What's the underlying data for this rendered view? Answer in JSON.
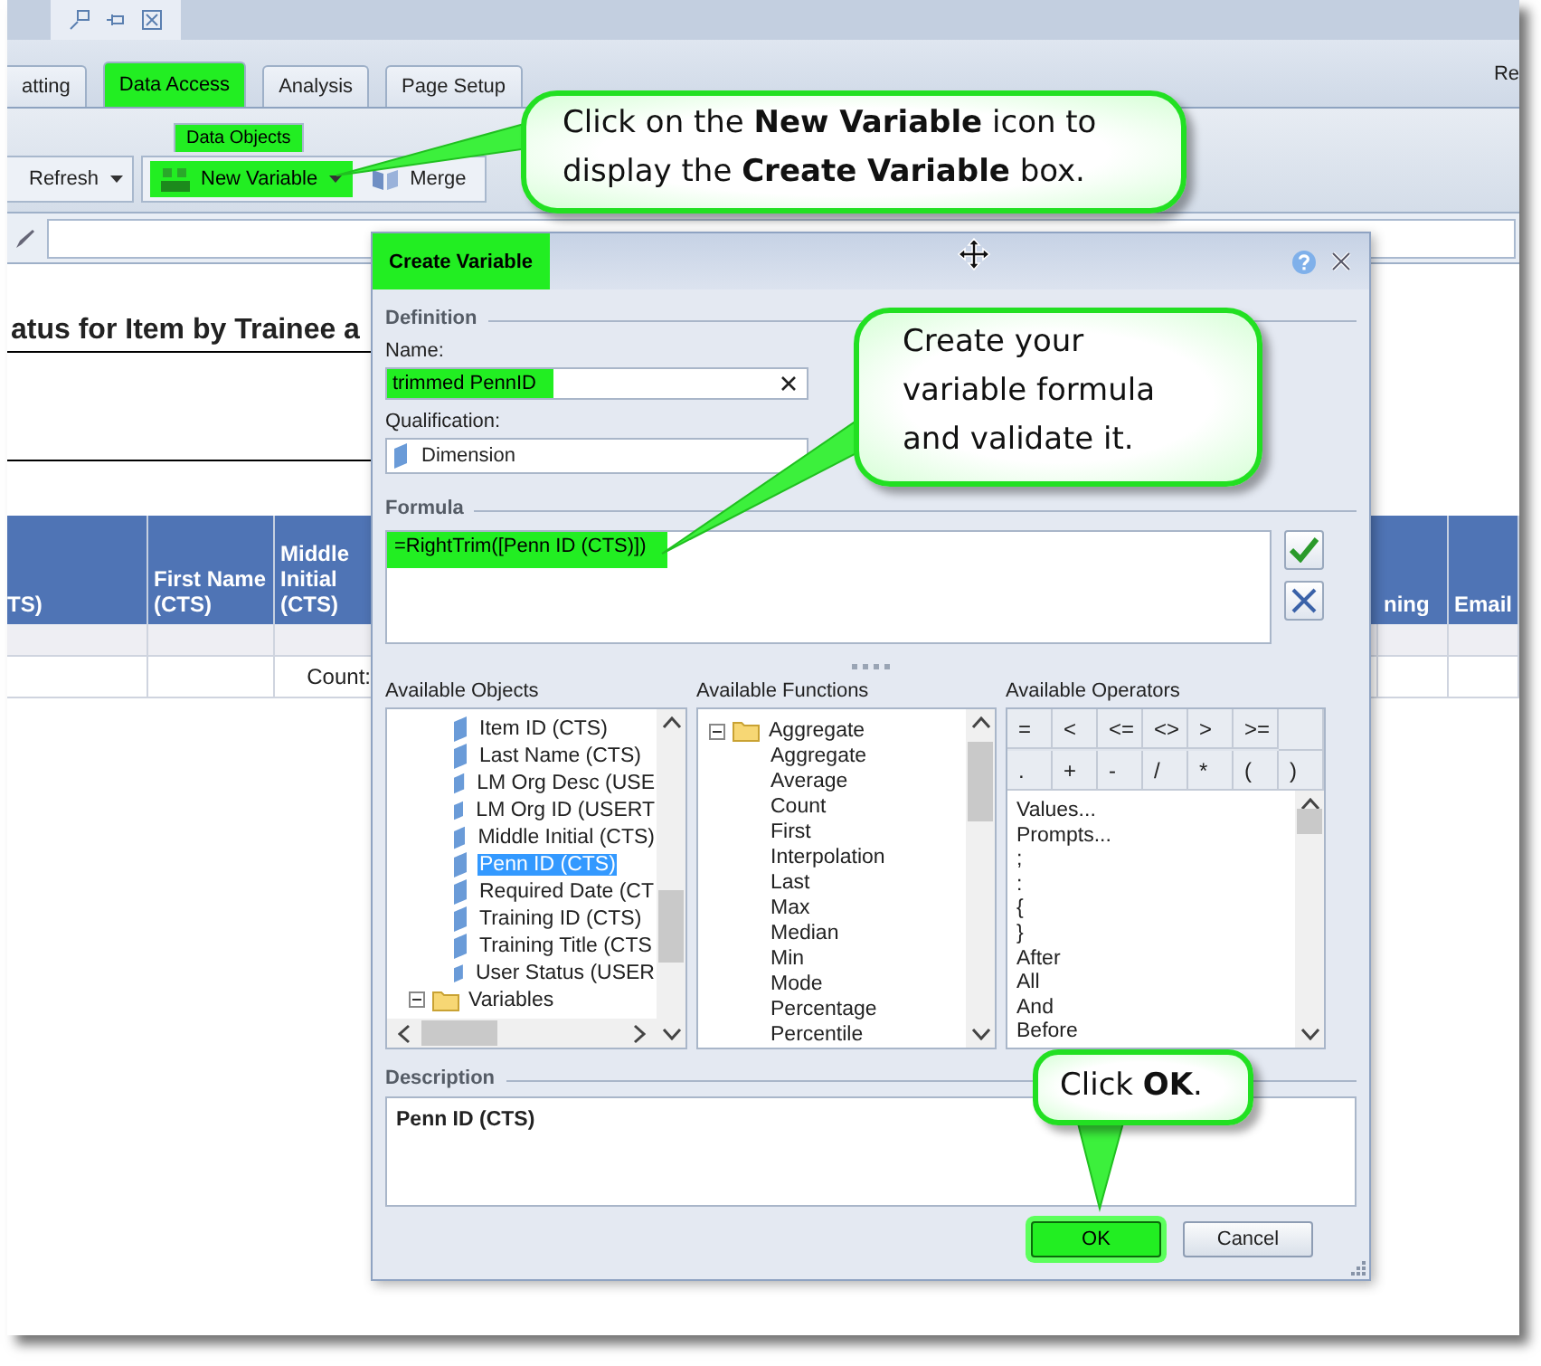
{
  "ribbon_tabs": [
    {
      "label": "atting",
      "selected": false,
      "highlighted": false
    },
    {
      "label": "Data Access",
      "selected": true,
      "highlighted": true
    },
    {
      "label": "Analysis",
      "selected": false,
      "highlighted": false
    },
    {
      "label": "Page Setup",
      "selected": false,
      "highlighted": false
    }
  ],
  "ribbon_right_text": "Re",
  "ribbon_group": {
    "label": "Data Objects",
    "highlighted": true
  },
  "ribbon_buttons": [
    {
      "label": "Refresh",
      "kind": "dropdown",
      "highlighted": false
    },
    {
      "label": "New Variable",
      "kind": "dropdown",
      "highlighted": true
    },
    {
      "label": "Merge",
      "kind": "plain",
      "highlighted": false
    }
  ],
  "report": {
    "title": "atus for Item by Trainee a",
    "columns": [
      {
        "label": "TS)"
      },
      {
        "label": "First Name (CTS)"
      },
      {
        "label": "Middle Initial (CTS)"
      },
      {
        "label": "ning"
      },
      {
        "label": "Email"
      }
    ],
    "count_label": "Count:"
  },
  "dialog": {
    "title": "Create Variable",
    "title_highlighted": true,
    "definition_heading": "Definition",
    "name_label": "Name:",
    "name_value": "trimmed PennID",
    "name_highlighted": true,
    "qualification_label": "Qualification:",
    "qualification_value": "Dimension",
    "formula_heading": "Formula",
    "formula": "=RightTrim([Penn ID (CTS)])",
    "formula_highlighted": true,
    "objects_heading": "Available Objects",
    "objects": [
      {
        "label": "Item ID (CTS)",
        "kind": "dimension",
        "selected": false
      },
      {
        "label": "Last Name (CTS)",
        "kind": "dimension",
        "selected": false
      },
      {
        "label": "LM Org Desc (USE",
        "kind": "dimension",
        "selected": false
      },
      {
        "label": "LM Org ID (USERT",
        "kind": "dimension",
        "selected": false
      },
      {
        "label": "Middle Initial (CTS)",
        "kind": "dimension",
        "selected": false
      },
      {
        "label": "Penn ID (CTS)",
        "kind": "dimension",
        "selected": true
      },
      {
        "label": "Required Date (CT",
        "kind": "dimension",
        "selected": false
      },
      {
        "label": "Training ID (CTS)",
        "kind": "dimension",
        "selected": false
      },
      {
        "label": "Training Title (CTS",
        "kind": "dimension",
        "selected": false
      },
      {
        "label": "User Status (USER",
        "kind": "dimension",
        "selected": false
      },
      {
        "label": "Variables",
        "kind": "folder",
        "selected": false,
        "expanded": true
      }
    ],
    "functions_heading": "Available Functions",
    "functions": [
      {
        "label": "Aggregate",
        "expanded": true,
        "children": [
          {
            "label": "Aggregate"
          },
          {
            "label": "Average"
          },
          {
            "label": "Count"
          },
          {
            "label": "First"
          },
          {
            "label": "Interpolation"
          },
          {
            "label": "Last"
          },
          {
            "label": "Max"
          },
          {
            "label": "Median"
          },
          {
            "label": "Min"
          },
          {
            "label": "Mode"
          },
          {
            "label": "Percentage"
          },
          {
            "label": "Percentile"
          }
        ]
      }
    ],
    "operators_heading": "Available Operators",
    "operator_keys": [
      [
        "=",
        "<",
        "<=",
        "<>",
        ">",
        ">="
      ],
      [
        ".",
        "+",
        "-",
        "/",
        "*",
        "(",
        ")"
      ]
    ],
    "operators": [
      "Values...",
      "Prompts...",
      ";",
      ":",
      "{",
      "}",
      "After",
      "All",
      "And",
      "Before"
    ],
    "description_heading": "Description",
    "description": "Penn ID (CTS)",
    "buttons": [
      {
        "label": "OK",
        "highlighted": true
      },
      {
        "label": "Cancel",
        "highlighted": false
      }
    ]
  },
  "callouts": [
    {
      "text": "Click on the **New Variable** icon to display the **Create Variable** box."
    },
    {
      "text": "Create your variable formula and validate it."
    },
    {
      "text": "Click **OK**."
    }
  ]
}
